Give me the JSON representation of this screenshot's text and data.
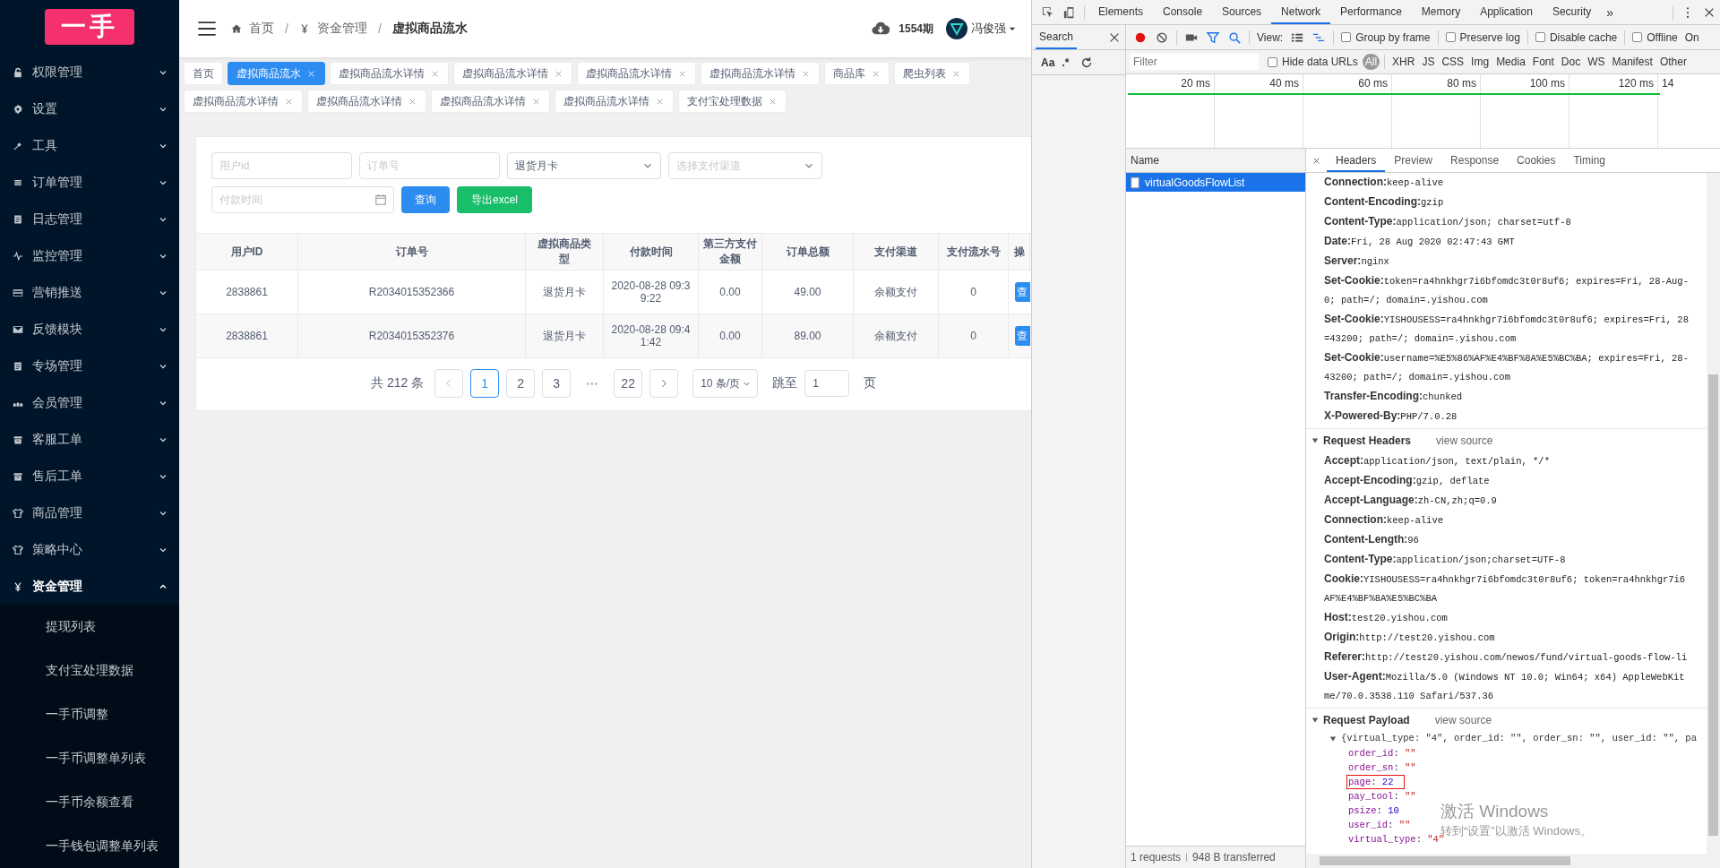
{
  "sidebar": {
    "logo": "一手",
    "items": [
      {
        "label": "权限管理",
        "expanded": false
      },
      {
        "label": "设置",
        "expanded": false
      },
      {
        "label": "工具",
        "expanded": false
      },
      {
        "label": "订单管理",
        "expanded": false
      },
      {
        "label": "日志管理",
        "expanded": false
      },
      {
        "label": "监控管理",
        "expanded": false
      },
      {
        "label": "营销推送",
        "expanded": false
      },
      {
        "label": "反馈模块",
        "expanded": false
      },
      {
        "label": "专场管理",
        "expanded": false
      },
      {
        "label": "会员管理",
        "expanded": false
      },
      {
        "label": "客服工单",
        "expanded": false
      },
      {
        "label": "售后工单",
        "expanded": false
      },
      {
        "label": "商品管理",
        "expanded": false
      },
      {
        "label": "策略中心",
        "expanded": false
      },
      {
        "label": "资金管理",
        "expanded": true,
        "children": [
          {
            "label": "提现列表"
          },
          {
            "label": "支付宝处理数据"
          },
          {
            "label": "一手币调整"
          },
          {
            "label": "一手币调整单列表"
          },
          {
            "label": "一手币余额查看"
          },
          {
            "label": "一手钱包调整单列表"
          }
        ]
      }
    ]
  },
  "header": {
    "breadcrumb": [
      {
        "label": "首页"
      },
      {
        "label": "资金管理"
      },
      {
        "label": "虚拟商品流水"
      }
    ],
    "separator": "/",
    "period": "1554期",
    "user": "冯俊强"
  },
  "tabs": [
    {
      "label": "首页",
      "selected": false,
      "closable": false
    },
    {
      "label": "虚拟商品流水",
      "selected": true,
      "closable": true
    },
    {
      "label": "虚拟商品流水详情",
      "selected": false,
      "closable": true
    },
    {
      "label": "虚拟商品流水详情",
      "selected": false,
      "closable": true
    },
    {
      "label": "虚拟商品流水详情",
      "selected": false,
      "closable": true
    },
    {
      "label": "虚拟商品流水详情",
      "selected": false,
      "closable": true
    },
    {
      "label": "商品库",
      "selected": false,
      "closable": true
    },
    {
      "label": "爬虫列表",
      "selected": false,
      "closable": true
    },
    {
      "label": "虚拟商品流水详情",
      "selected": false,
      "closable": true
    },
    {
      "label": "虚拟商品流水详情",
      "selected": false,
      "closable": true
    },
    {
      "label": "虚拟商品流水详情",
      "selected": false,
      "closable": true
    },
    {
      "label": "虚拟商品流水详情",
      "selected": false,
      "closable": true
    },
    {
      "label": "支付宝处理数据",
      "selected": false,
      "closable": true
    }
  ],
  "filters": {
    "fields": [
      {
        "kind": "input",
        "placeholder": "用户id"
      },
      {
        "kind": "input",
        "placeholder": "订单号"
      },
      {
        "kind": "select",
        "value": "退货月卡"
      },
      {
        "kind": "select",
        "placeholder": "选择支付渠道"
      },
      {
        "kind": "date",
        "placeholder": "付款时间"
      }
    ],
    "buttons": [
      {
        "label": "查询",
        "kind": "primary"
      },
      {
        "label": "导出excel",
        "kind": "success"
      }
    ]
  },
  "table": {
    "columns": [
      "用户ID",
      "订单号",
      "虚拟商品类型",
      "付款时间",
      "第三方支付金额",
      "订单总额",
      "支付渠道",
      "支付流水号",
      "操"
    ],
    "rows": [
      {
        "cells": [
          "2838861",
          "R2034015352366",
          "退货月卡",
          "2020-08-28 09:39:22",
          "0.00",
          "49.00",
          "余额支付",
          "0"
        ],
        "action": "查"
      },
      {
        "cells": [
          "2838861",
          "R2034015352376",
          "退货月卡",
          "2020-08-28 09:41:42",
          "0.00",
          "89.00",
          "余额支付",
          "0"
        ],
        "action": "查"
      }
    ]
  },
  "pagination": {
    "total": "共 212 条",
    "pages": [
      {
        "kind": "page",
        "label": "1",
        "selected": true
      },
      {
        "kind": "page",
        "label": "2",
        "selected": false
      },
      {
        "kind": "page",
        "label": "3",
        "selected": false
      },
      {
        "kind": "ellipsis",
        "label": "•••",
        "selected": false
      },
      {
        "kind": "page",
        "label": "22",
        "selected": false
      }
    ],
    "page_size": "10 条/页",
    "jump_label": "跳至",
    "jump_value": "1",
    "jump_suffix": "页"
  },
  "devtools": {
    "tabs": [
      {
        "label": "Elements",
        "selected": false
      },
      {
        "label": "Console",
        "selected": false
      },
      {
        "label": "Sources",
        "selected": false
      },
      {
        "label": "Network",
        "selected": true
      },
      {
        "label": "Performance",
        "selected": false
      },
      {
        "label": "Memory",
        "selected": false
      },
      {
        "label": "Application",
        "selected": false
      },
      {
        "label": "Security",
        "selected": false
      }
    ],
    "more": "»",
    "search_panel": {
      "title": "Search",
      "case_toggle": "Aa",
      "regex_toggle": ".*"
    },
    "toolbar": {
      "view_label": "View:",
      "checkboxes": [
        {
          "label": "Group by frame",
          "checked": false
        },
        {
          "label": "Preserve log",
          "checked": false
        },
        {
          "label": "Disable cache",
          "checked": false
        },
        {
          "label": "Offline",
          "checked": false
        }
      ],
      "throttling": "On"
    },
    "filter": {
      "placeholder": "Filter",
      "hide_data_urls": {
        "label": "Hide data URLs",
        "checked": false
      },
      "types": [
        {
          "label": "All",
          "selected": true
        },
        {
          "label": "XHR",
          "selected": false
        },
        {
          "label": "JS",
          "selected": false
        },
        {
          "label": "CSS",
          "selected": false
        },
        {
          "label": "Img",
          "selected": false
        },
        {
          "label": "Media",
          "selected": false
        },
        {
          "label": "Font",
          "selected": false
        },
        {
          "label": "Doc",
          "selected": false
        },
        {
          "label": "WS",
          "selected": false
        },
        {
          "label": "Manifest",
          "selected": false
        },
        {
          "label": "Other",
          "selected": false
        }
      ]
    },
    "overview_ticks": [
      "20 ms",
      "40 ms",
      "60 ms",
      "80 ms",
      "100 ms",
      "120 ms",
      "14"
    ],
    "name_header": "Name",
    "requests": [
      {
        "name": "virtualGoodsFlowList",
        "selected": true
      }
    ],
    "detail_tabs": [
      {
        "label": "Headers",
        "selected": true
      },
      {
        "label": "Preview",
        "selected": false
      },
      {
        "label": "Response",
        "selected": false
      },
      {
        "label": "Cookies",
        "selected": false
      },
      {
        "label": "Timing",
        "selected": false
      }
    ],
    "response_headers": [
      {
        "name": "Connection:",
        "value": [
          "keep-alive"
        ]
      },
      {
        "name": "Content-Encoding:",
        "value": [
          "gzip"
        ]
      },
      {
        "name": "Content-Type:",
        "value": [
          "application/json; charset=utf-8"
        ]
      },
      {
        "name": "Date:",
        "value": [
          "Fri, 28 Aug 2020 02:47:43 GMT"
        ]
      },
      {
        "name": "Server:",
        "value": [
          "nginx"
        ]
      },
      {
        "name": "Set-Cookie:",
        "value": [
          "token=ra4hnkhgr7i6bfomdc3t0r8uf6; expires=Fri, 28-Aug-",
          "0; path=/; domain=.yishou.com"
        ]
      },
      {
        "name": "Set-Cookie:",
        "value": [
          "YISHOUSESS=ra4hnkhgr7i6bfomdc3t0r8uf6; expires=Fri, 28",
          "=43200; path=/; domain=.yishou.com"
        ]
      },
      {
        "name": "Set-Cookie:",
        "value": [
          "username=%E5%86%AF%E4%BF%8A%E5%BC%BA; expires=Fri, 28-",
          "43200; path=/; domain=.yishou.com"
        ]
      },
      {
        "name": "Transfer-Encoding:",
        "value": [
          "chunked"
        ]
      },
      {
        "name": "X-Powered-By:",
        "value": [
          "PHP/7.0.28"
        ]
      }
    ],
    "request_headers": {
      "title": "Request Headers",
      "view_source": "view source",
      "expanded": true,
      "items": [
        {
          "name": "Accept:",
          "value": [
            "application/json, text/plain, */*"
          ]
        },
        {
          "name": "Accept-Encoding:",
          "value": [
            "gzip, deflate"
          ]
        },
        {
          "name": "Accept-Language:",
          "value": [
            "zh-CN,zh;q=0.9"
          ]
        },
        {
          "name": "Connection:",
          "value": [
            "keep-alive"
          ]
        },
        {
          "name": "Content-Length:",
          "value": [
            "96"
          ]
        },
        {
          "name": "Content-Type:",
          "value": [
            "application/json;charset=UTF-8"
          ]
        },
        {
          "name": "Cookie:",
          "value": [
            "YISHOUSESS=ra4hnkhgr7i6bfomdc3t0r8uf6; token=ra4hnkhgr7i6",
            "AF%E4%BF%8A%E5%BC%BA"
          ]
        },
        {
          "name": "Host:",
          "value": [
            "test20.yishou.com"
          ]
        },
        {
          "name": "Origin:",
          "value": [
            "http://test20.yishou.com"
          ]
        },
        {
          "name": "Referer:",
          "value": [
            "http://test20.yishou.com/newos/fund/virtual-goods-flow-li"
          ]
        },
        {
          "name": "User-Agent:",
          "value": [
            "Mozilla/5.0 (Windows NT 10.0; Win64; x64) AppleWebKit",
            "me/70.0.3538.110 Safari/537.36"
          ]
        }
      ]
    },
    "request_payload": {
      "title": "Request Payload",
      "view_source": "view source",
      "expanded": true,
      "summary": "{virtual_type: \"4\", order_id: \"\", order_sn: \"\", user_id: \"\", pa",
      "separator": ":",
      "props": [
        {
          "key": "order_id",
          "value": "\"\"",
          "kind": "string",
          "highlighted": false
        },
        {
          "key": "order_sn",
          "value": "\"\"",
          "kind": "string",
          "highlighted": false
        },
        {
          "key": "page",
          "value": "22",
          "kind": "number",
          "highlighted": true
        },
        {
          "key": "pay_tool",
          "value": "\"\"",
          "kind": "string",
          "highlighted": false
        },
        {
          "key": "psize",
          "value": "10",
          "kind": "number",
          "highlighted": false
        },
        {
          "key": "user_id",
          "value": "\"\"",
          "kind": "string",
          "highlighted": false
        },
        {
          "key": "virtual_type",
          "value": "\"4\"",
          "kind": "string",
          "highlighted": false
        }
      ]
    },
    "status": [
      "1 requests",
      "948 B transferred"
    ]
  },
  "os_notice": {
    "title": "激活 Windows",
    "text": "转到“设置”以激活 Windows。"
  }
}
